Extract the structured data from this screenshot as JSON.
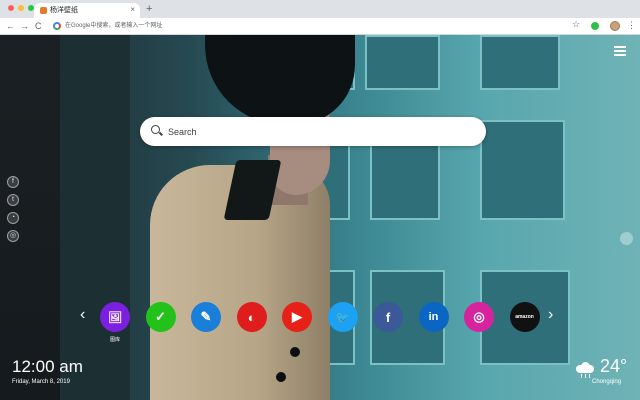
{
  "browser": {
    "tab_title": "杨洋壁纸",
    "tab_close": "×",
    "new_tab": "+",
    "omnibox_placeholder": "在Google中搜索，或者输入一个网址",
    "nav_back": "←",
    "nav_forward": "→",
    "nav_reload": "C",
    "bookmark_star": "☆",
    "menu_kebab": "⋮"
  },
  "search": {
    "placeholder": "Search"
  },
  "social_icons": [
    "facebook-icon",
    "twitter-icon",
    "snapchat-icon",
    "wechat-icon"
  ],
  "apps": {
    "prev": "‹",
    "next": "›",
    "first_label": "图库",
    "items": [
      {
        "name": "gallery",
        "color": "#7b1fe0",
        "glyph": "🖼"
      },
      {
        "name": "tasks",
        "color": "#22c21b",
        "glyph": "✓"
      },
      {
        "name": "notes",
        "color": "#1a7fd8",
        "glyph": "✎"
      },
      {
        "name": "games",
        "color": "#e01d1d",
        "glyph": "◐"
      },
      {
        "name": "youtube",
        "color": "#e62117",
        "glyph": "▶"
      },
      {
        "name": "twitter",
        "color": "#1da1f2",
        "glyph": "🐦"
      },
      {
        "name": "facebook",
        "color": "#3b5998",
        "glyph": "f"
      },
      {
        "name": "linkedin",
        "color": "#0a66c2",
        "glyph": "in"
      },
      {
        "name": "instagram",
        "color": "#d6249f",
        "glyph": "◎"
      },
      {
        "name": "amazon",
        "color": "#111111",
        "glyph": "amazon"
      }
    ]
  },
  "clock": {
    "time": "12:00 am",
    "date": "Friday, March 8, 2019"
  },
  "weather": {
    "temp": "24°",
    "city": "Chongqing"
  }
}
